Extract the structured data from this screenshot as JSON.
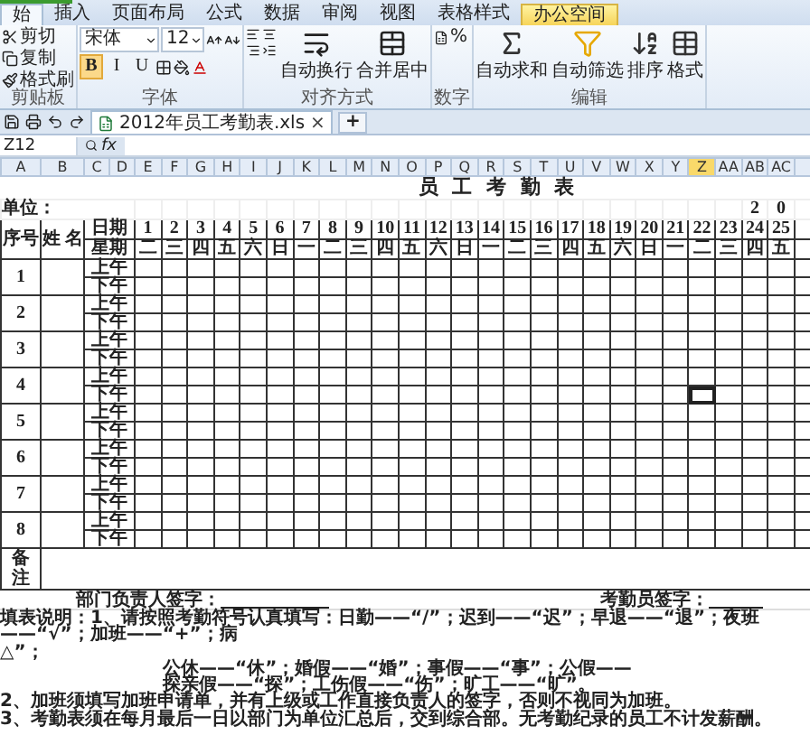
{
  "ribbon": {
    "tabs": [
      {
        "label": "始",
        "selected": true,
        "kind": "normal"
      },
      {
        "label": "插入",
        "selected": false,
        "kind": "normal"
      },
      {
        "label": "页面布局",
        "selected": false,
        "kind": "normal"
      },
      {
        "label": "公式",
        "selected": false,
        "kind": "normal"
      },
      {
        "label": "数据",
        "selected": false,
        "kind": "normal"
      },
      {
        "label": "审阅",
        "selected": false,
        "kind": "normal"
      },
      {
        "label": "视图",
        "selected": false,
        "kind": "normal"
      },
      {
        "label": "表格样式",
        "selected": false,
        "kind": "normal"
      },
      {
        "label": "办公空间",
        "selected": false,
        "kind": "highlight"
      }
    ],
    "groups": [
      {
        "kind": "clipboard",
        "label": "剪贴板",
        "items": [
          "剪切",
          "复制",
          "格式刷"
        ]
      },
      {
        "kind": "font",
        "label": "字体",
        "font": "宋体",
        "size": "12",
        "styles": [
          {
            "label": "B",
            "selected": true
          },
          {
            "label": "I",
            "selected": false
          },
          {
            "label": "U",
            "selected": false
          }
        ]
      },
      {
        "kind": "align",
        "label": "对齐方式",
        "buttons": [
          "自动换行",
          "合并居中"
        ]
      },
      {
        "kind": "number",
        "label": "数字",
        "symbol": "%"
      },
      {
        "kind": "edit",
        "label": "编辑",
        "buttons": [
          "自动求和",
          "自动筛选",
          "排序",
          "格式"
        ]
      }
    ]
  },
  "doc_tab": {
    "title": "2012年员工考勤表.xls",
    "close": "×",
    "add": "+"
  },
  "formula_bar": {
    "cell": "Z12",
    "fx": "fx"
  },
  "columns": [
    {
      "label": "A",
      "selected": false
    },
    {
      "label": "B",
      "selected": false
    },
    {
      "label": "C",
      "selected": false
    },
    {
      "label": "D",
      "selected": false
    },
    {
      "label": "E",
      "selected": false
    },
    {
      "label": "F",
      "selected": false
    },
    {
      "label": "G",
      "selected": false
    },
    {
      "label": "H",
      "selected": false
    },
    {
      "label": "I",
      "selected": false
    },
    {
      "label": "J",
      "selected": false
    },
    {
      "label": "K",
      "selected": false
    },
    {
      "label": "L",
      "selected": false
    },
    {
      "label": "M",
      "selected": false
    },
    {
      "label": "N",
      "selected": false
    },
    {
      "label": "O",
      "selected": false
    },
    {
      "label": "P",
      "selected": false
    },
    {
      "label": "Q",
      "selected": false
    },
    {
      "label": "R",
      "selected": false
    },
    {
      "label": "S",
      "selected": false
    },
    {
      "label": "T",
      "selected": false
    },
    {
      "label": "U",
      "selected": false
    },
    {
      "label": "V",
      "selected": false
    },
    {
      "label": "W",
      "selected": false
    },
    {
      "label": "X",
      "selected": false
    },
    {
      "label": "Y",
      "selected": false
    },
    {
      "label": "Z",
      "selected": true
    },
    {
      "label": "AA",
      "selected": false
    },
    {
      "label": "AB",
      "selected": false
    },
    {
      "label": "AC",
      "selected": false
    }
  ],
  "sheet": {
    "title": "员 工 考 勤 表",
    "unit_label": "单位：",
    "year_digits": [
      "2",
      "0"
    ],
    "number_header": "序号",
    "name_header": "姓 名",
    "date_header": "日期",
    "weekday_header": "星期",
    "dates": [
      {
        "day": "1",
        "weekday": "二"
      },
      {
        "day": "2",
        "weekday": "三"
      },
      {
        "day": "3",
        "weekday": "四"
      },
      {
        "day": "4",
        "weekday": "五"
      },
      {
        "day": "5",
        "weekday": "六"
      },
      {
        "day": "6",
        "weekday": "日"
      },
      {
        "day": "7",
        "weekday": "一"
      },
      {
        "day": "8",
        "weekday": "二"
      },
      {
        "day": "9",
        "weekday": "三"
      },
      {
        "day": "10",
        "weekday": "四"
      },
      {
        "day": "11",
        "weekday": "五"
      },
      {
        "day": "12",
        "weekday": "六"
      },
      {
        "day": "13",
        "weekday": "日"
      },
      {
        "day": "14",
        "weekday": "一"
      },
      {
        "day": "15",
        "weekday": "二"
      },
      {
        "day": "16",
        "weekday": "三"
      },
      {
        "day": "17",
        "weekday": "四"
      },
      {
        "day": "18",
        "weekday": "五"
      },
      {
        "day": "19",
        "weekday": "六"
      },
      {
        "day": "20",
        "weekday": "日"
      },
      {
        "day": "21",
        "weekday": "一"
      },
      {
        "day": "22",
        "weekday": "二"
      },
      {
        "day": "23",
        "weekday": "三"
      },
      {
        "day": "24",
        "weekday": "四"
      },
      {
        "day": "25",
        "weekday": "五"
      }
    ],
    "employees": [
      {
        "number": "1",
        "halves": [
          {
            "label": "上午",
            "selected": false
          },
          {
            "label": "下午",
            "selected": false
          }
        ]
      },
      {
        "number": "2",
        "halves": [
          {
            "label": "上午",
            "selected": false
          },
          {
            "label": "下午",
            "selected": false
          }
        ]
      },
      {
        "number": "3",
        "halves": [
          {
            "label": "上午",
            "selected": false
          },
          {
            "label": "下午",
            "selected": false
          }
        ]
      },
      {
        "number": "4",
        "halves": [
          {
            "label": "上午",
            "selected": false
          },
          {
            "label": "下午",
            "selected": true
          }
        ]
      },
      {
        "number": "5",
        "halves": [
          {
            "label": "上午",
            "selected": false
          },
          {
            "label": "下午",
            "selected": false
          }
        ]
      },
      {
        "number": "6",
        "halves": [
          {
            "label": "上午",
            "selected": false
          },
          {
            "label": "下午",
            "selected": false
          }
        ]
      },
      {
        "number": "7",
        "halves": [
          {
            "label": "上午",
            "selected": false
          },
          {
            "label": "下午",
            "selected": false
          }
        ]
      },
      {
        "number": "8",
        "halves": [
          {
            "label": "上午",
            "selected": false
          },
          {
            "label": "下午",
            "selected": false
          }
        ]
      }
    ],
    "remarks_label": "备注",
    "signatures": [
      "部门负责人签字：",
      "考勤员签字："
    ],
    "notes": [
      {
        "text": "填表说明：1、请按照考勤符号认真填写：日勤——“/”；迟到——“迟”；早退——“退”；夜班——“√”；加班——“+”；病",
        "indent": false
      },
      {
        "text": "△”；",
        "indent": false
      },
      {
        "text": "公休——“休”；婚假——“婚”；事假——“事”；公假——",
        "indent": true
      },
      {
        "text": "探亲假——“探”；工伤假——“伤”；旷工——“旷”。",
        "indent": true
      },
      {
        "text": "2、加班须填写加班申请单，并有上级或工作直接负责人的签字，否则不视同为加班。",
        "indent": false
      },
      {
        "text": "3、考勤表须在每月最后一日以部门为单位汇总后，交到综合部。无考勤纪录的员工不计发薪酬。",
        "indent": false
      }
    ]
  }
}
